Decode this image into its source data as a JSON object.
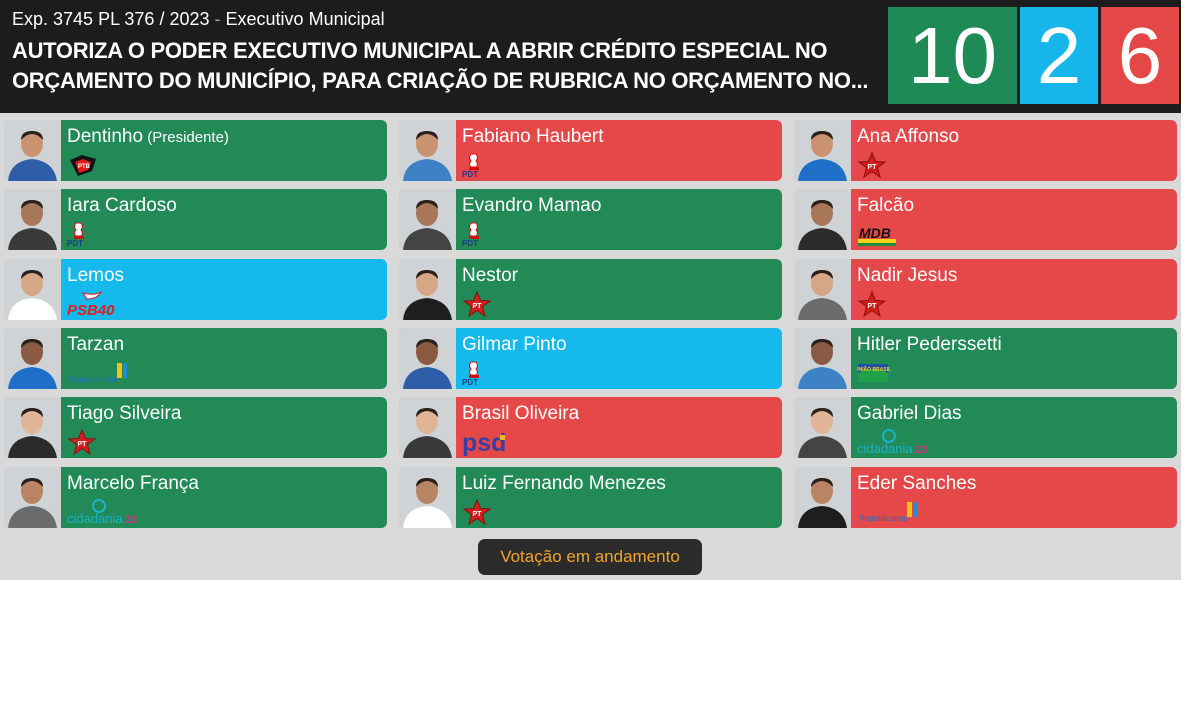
{
  "header": {
    "reference": "Exp. 3745 PL 376 / 2023",
    "separator": "-",
    "author": "Executivo Municipal",
    "title": "AUTORIZA O PODER EXECUTIVO MUNICIPAL A ABRIR CRÉDITO ESPECIAL NO ORÇAMENTO DO MUNICÍPIO, PARA CRIAÇÃO DE RUBRICA NO ORÇAMENTO NO..."
  },
  "tally": {
    "yes": "10",
    "abstain": "2",
    "no": "6"
  },
  "colors": {
    "yes": "#218a57",
    "no": "#e54848",
    "abstain": "#16b9ec",
    "header": "#1c1c1c",
    "status_text": "#f0a52a"
  },
  "councillors": [
    {
      "name": "Dentinho",
      "note": "(Presidente)",
      "vote": "yes",
      "party_logo": "ptb-logo"
    },
    {
      "name": "Iara Cardoso",
      "note": "",
      "vote": "yes",
      "party_logo": "pdt-logo"
    },
    {
      "name": "Lemos",
      "note": "",
      "vote": "abstain",
      "party_logo": "psb-logo"
    },
    {
      "name": "Tarzan",
      "note": "",
      "vote": "yes",
      "party_logo": "republicanos-logo"
    },
    {
      "name": "Tiago Silveira",
      "note": "",
      "vote": "yes",
      "party_logo": "pt-logo"
    },
    {
      "name": "Marcelo França",
      "note": "",
      "vote": "yes",
      "party_logo": "cidadania-logo"
    },
    {
      "name": "Fabiano Haubert",
      "note": "",
      "vote": "no",
      "party_logo": "pdt-logo"
    },
    {
      "name": "Evandro Mamao",
      "note": "",
      "vote": "yes",
      "party_logo": "pdt-logo"
    },
    {
      "name": "Nestor",
      "note": "",
      "vote": "yes",
      "party_logo": "pt-logo"
    },
    {
      "name": "Gilmar Pinto",
      "note": "",
      "vote": "abstain",
      "party_logo": "pdt-logo"
    },
    {
      "name": "Brasil Oliveira",
      "note": "",
      "vote": "no",
      "party_logo": "psd-logo"
    },
    {
      "name": "Luiz Fernando Menezes",
      "note": "",
      "vote": "yes",
      "party_logo": "pt-logo"
    },
    {
      "name": "Ana Affonso",
      "note": "",
      "vote": "no",
      "party_logo": "pt-logo"
    },
    {
      "name": "Falcão",
      "note": "",
      "vote": "no",
      "party_logo": "mdb-logo"
    },
    {
      "name": "Nadir Jesus",
      "note": "",
      "vote": "no",
      "party_logo": "pt-logo"
    },
    {
      "name": "Hitler Pederssetti",
      "note": "",
      "vote": "yes",
      "party_logo": "uniao-brasil-logo"
    },
    {
      "name": "Gabriel Dias",
      "note": "",
      "vote": "yes",
      "party_logo": "cidadania-logo"
    },
    {
      "name": "Eder Sanches",
      "note": "",
      "vote": "no",
      "party_logo": "republicanos-logo"
    }
  ],
  "logo_text": {
    "pt": "PT",
    "pdt": "PDT",
    "ptb": "PTB",
    "psb": "PSB40",
    "psd": "psd",
    "mdb": "MDB",
    "cidadania": "cidadania",
    "cidadania_number": "23",
    "republicanos": "Republicanos",
    "uniao": "UNIÃO BRASIL"
  },
  "status": "Votação em andamento"
}
